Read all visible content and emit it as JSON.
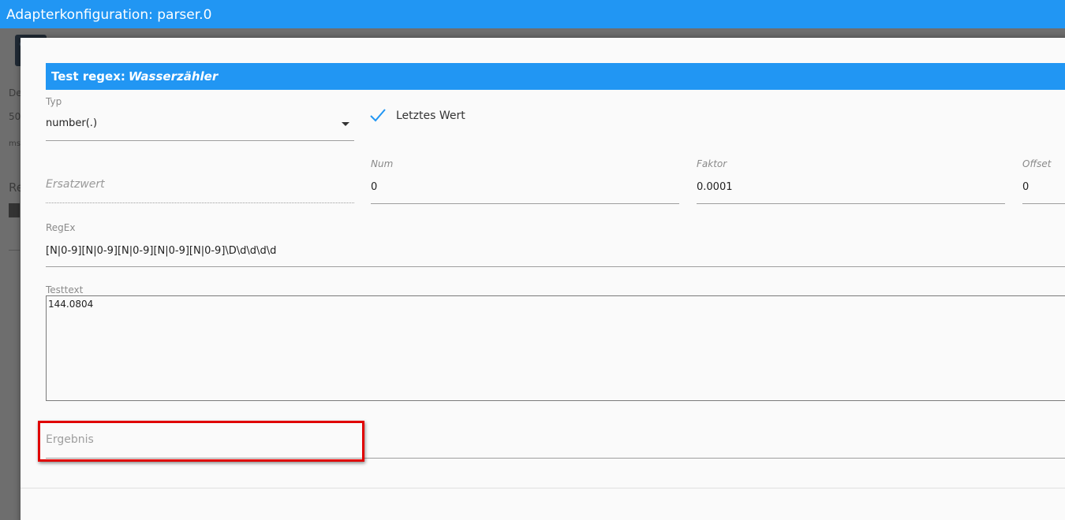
{
  "window": {
    "title": "Adapterkonfiguration: parser.0"
  },
  "background": {
    "fragments": [
      "De",
      "50",
      "ms",
      "Re"
    ]
  },
  "dialog": {
    "title_prefix": "Test regex:",
    "title_name": "Wasserzähler",
    "typ": {
      "label": "Typ",
      "value": "number(.)"
    },
    "letztes_wert": {
      "label": "Letztes Wert",
      "checked": true
    },
    "ersatzwert": {
      "placeholder": "Ersatzwert"
    },
    "num": {
      "label": "Num",
      "value": "0"
    },
    "faktor": {
      "label": "Faktor",
      "value": "0.0001"
    },
    "offset": {
      "label": "Offset",
      "value": "0"
    },
    "regex": {
      "label": "RegEx",
      "value": "[N|0-9][N|0-9][N|0-9][N|0-9][N|0-9]\\D\\d\\d\\d\\d"
    },
    "testtext": {
      "label": "Testtext",
      "value": "144.0804"
    },
    "ergebnis": {
      "label": "Ergebnis"
    }
  },
  "colors": {
    "accent": "#2196f3",
    "highlight": "#e00000"
  }
}
